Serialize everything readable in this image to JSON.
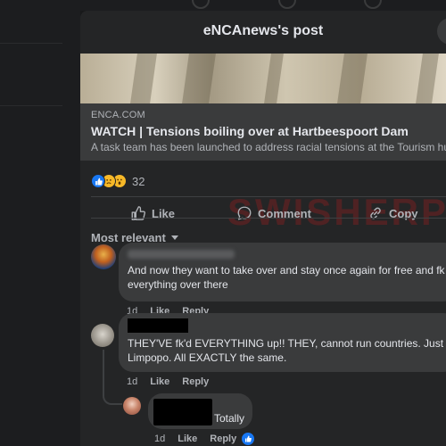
{
  "post": {
    "title": "eNCAnews's post",
    "link_domain": "ENCA.COM",
    "link_title": "WATCH | Tensions boiling over at Hartbeespoort Dam",
    "link_description": "A task team has been launched to address racial tensions at the Tourism hub",
    "reaction_count": "32"
  },
  "actions": {
    "like": "Like",
    "comment": "Comment",
    "copy": "Copy"
  },
  "watermark": "SWISHERPO",
  "sort_label": "Most relevant",
  "comments": [
    {
      "line1": "And now they want to take over and stay once again for free and fk up",
      "line2": "everything over there",
      "time": "1d",
      "like": "Like",
      "reply": "Reply"
    },
    {
      "line1": "THEY'VE fk'd EVERYTHING up!! THEY, cannot run countries. Just loo",
      "line2": "Limpopo. All EXACTLY the same.",
      "time": "1d",
      "like": "Like",
      "reply": "Reply"
    },
    {
      "line1": "Totally",
      "time": "1d",
      "like": "Like",
      "reply": "Reply"
    }
  ],
  "icons": {
    "like": "thumbs-up-icon",
    "comment": "comment-bubble-icon",
    "copy": "link-icon",
    "sort": "chevron-down-icon"
  },
  "colors": {
    "background": "#18191a",
    "modal": "#242526",
    "bubble": "#3a3b3c",
    "like_blue": "#1877f2",
    "watermark_red": "#be1e1e"
  }
}
